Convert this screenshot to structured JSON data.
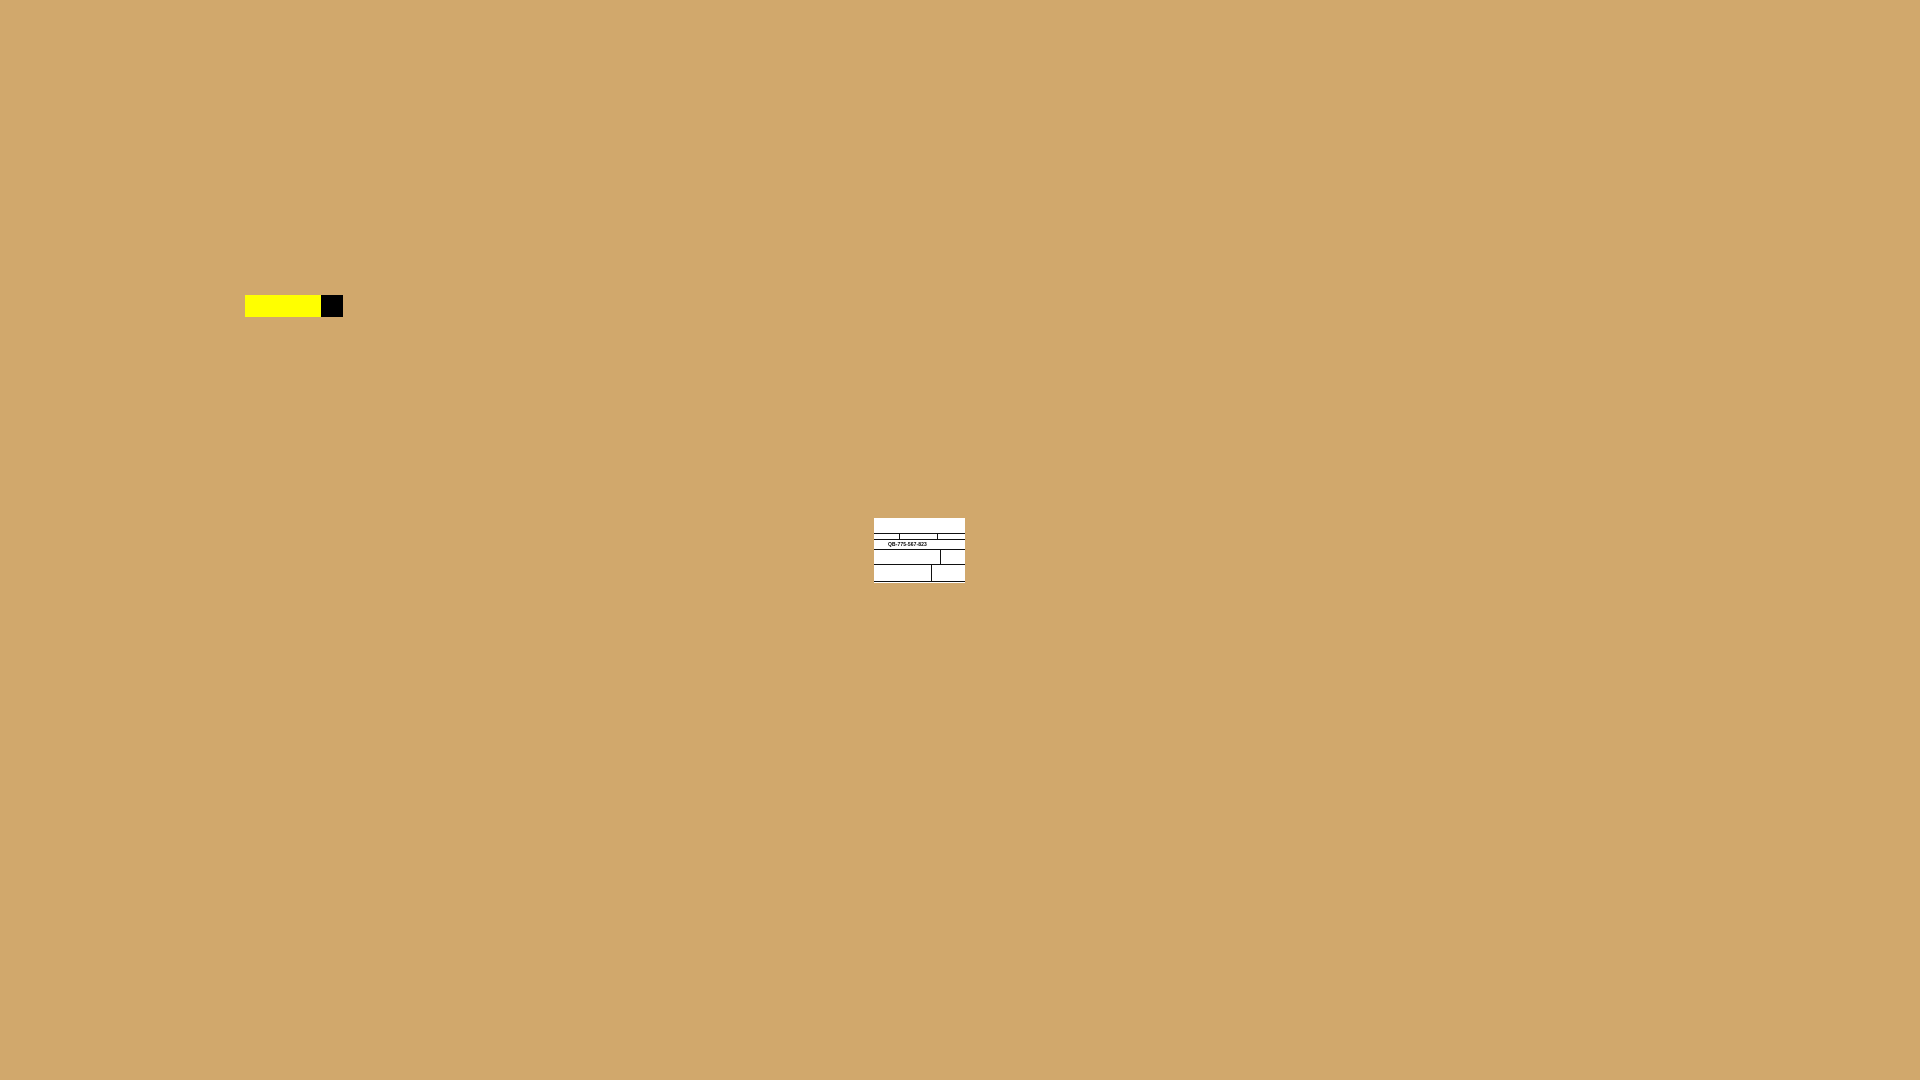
{
  "scene": {
    "background_color": "#D1A86C"
  },
  "indicator": {
    "fill_color": "#FFFF00",
    "end_color": "#000000"
  },
  "card": {
    "background_color": "#FFFFFF",
    "code": "QB-775-567-823"
  }
}
